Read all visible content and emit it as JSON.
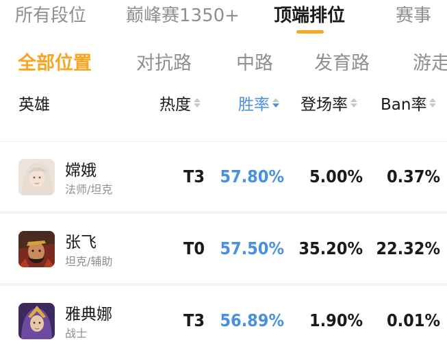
{
  "top_tabs": [
    {
      "label": "所有段位"
    },
    {
      "label": "巅峰赛1350+"
    },
    {
      "label": "顶端排位"
    },
    {
      "label": "赛事"
    }
  ],
  "position_tabs": [
    {
      "label": "全部位置"
    },
    {
      "label": "对抗路"
    },
    {
      "label": "中路"
    },
    {
      "label": "发育路"
    },
    {
      "label": "游走"
    }
  ],
  "table": {
    "columns": {
      "hero": "英雄",
      "heat": "热度",
      "win_rate": "胜率",
      "pick_rate": "登场率",
      "ban_rate": "Ban率"
    },
    "rows": [
      {
        "name": "嫦娥",
        "roles": "法师/坦克",
        "tier": "T3",
        "win_rate": "57.80%",
        "pick_rate": "5.00%",
        "ban_rate": "0.37%"
      },
      {
        "name": "张飞",
        "roles": "坦克/辅助",
        "tier": "T0",
        "win_rate": "57.50%",
        "pick_rate": "35.20%",
        "ban_rate": "22.32%"
      },
      {
        "name": "雅典娜",
        "roles": "战士",
        "tier": "T3",
        "win_rate": "56.89%",
        "pick_rate": "1.90%",
        "ban_rate": "0.01%"
      }
    ]
  },
  "colors": {
    "accent_orange": "#f5a623",
    "accent_blue": "#4a90e2",
    "muted_text": "#8e8e93"
  }
}
